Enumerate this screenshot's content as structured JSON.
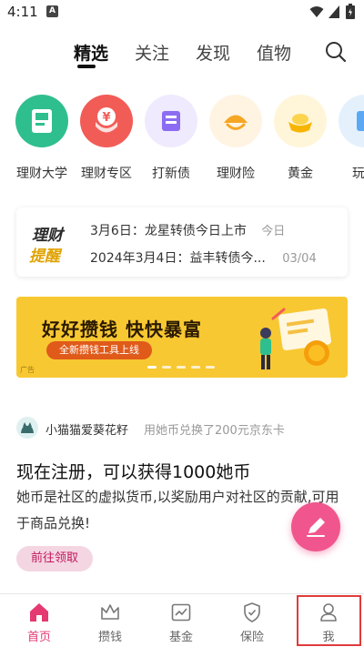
{
  "status_bar": {
    "time": "4:11",
    "app_indicator": "A"
  },
  "top_tabs": [
    {
      "label": "精选",
      "active": true
    },
    {
      "label": "关注",
      "active": false
    },
    {
      "label": "发现",
      "active": false
    },
    {
      "label": "值物",
      "active": false
    }
  ],
  "shortcuts": [
    {
      "label": "理财大学",
      "icon": "book-icon",
      "color": "#2fbf8f"
    },
    {
      "label": "理财专区",
      "icon": "yuan-coin-icon",
      "color": "#f25c57"
    },
    {
      "label": "打新债",
      "icon": "bond-document-icon",
      "color": "#8b6cf2"
    },
    {
      "label": "理财险",
      "icon": "umbrella-shield-icon",
      "color": "#f5a623"
    },
    {
      "label": "黄金",
      "icon": "gold-ingot-icon",
      "color": "#f7b500"
    },
    {
      "label": "玩转",
      "icon": "partial-icon",
      "color": "#5aa9f2"
    }
  ],
  "notice": {
    "logo_line1": "理财",
    "logo_line2": "提醒",
    "items": [
      {
        "text": "3月6日：龙星转债今日上市",
        "meta": "今日"
      },
      {
        "text": "2024年3月4日：益丰转债今...",
        "meta": "03/04"
      }
    ]
  },
  "banner": {
    "title": "好好攒钱 快快暴富",
    "subtitle": "全新攒钱工具上线",
    "ad_tag": "广告",
    "bg_color": "#f8c832"
  },
  "post": {
    "user": "小猫猫爱葵花籽",
    "action": "用她币兑换了200元京东卡",
    "title": "现在注册，可以获得1000她币",
    "body": "她币是社区的虚拟货币,以奖励用户对社区的贡献,可用于商品兑换!",
    "button_label": "前往领取"
  },
  "bottom_nav": [
    {
      "label": "首页",
      "icon": "home-icon",
      "active": true
    },
    {
      "label": "攒钱",
      "icon": "crown-icon",
      "active": false
    },
    {
      "label": "基金",
      "icon": "chart-icon",
      "active": false
    },
    {
      "label": "保险",
      "icon": "shield-icon",
      "active": false
    },
    {
      "label": "我",
      "icon": "profile-icon",
      "active": false
    }
  ],
  "colors": {
    "accent": "#e53972",
    "fab": "#f0568d",
    "highlight_box": "#e03b3b"
  }
}
